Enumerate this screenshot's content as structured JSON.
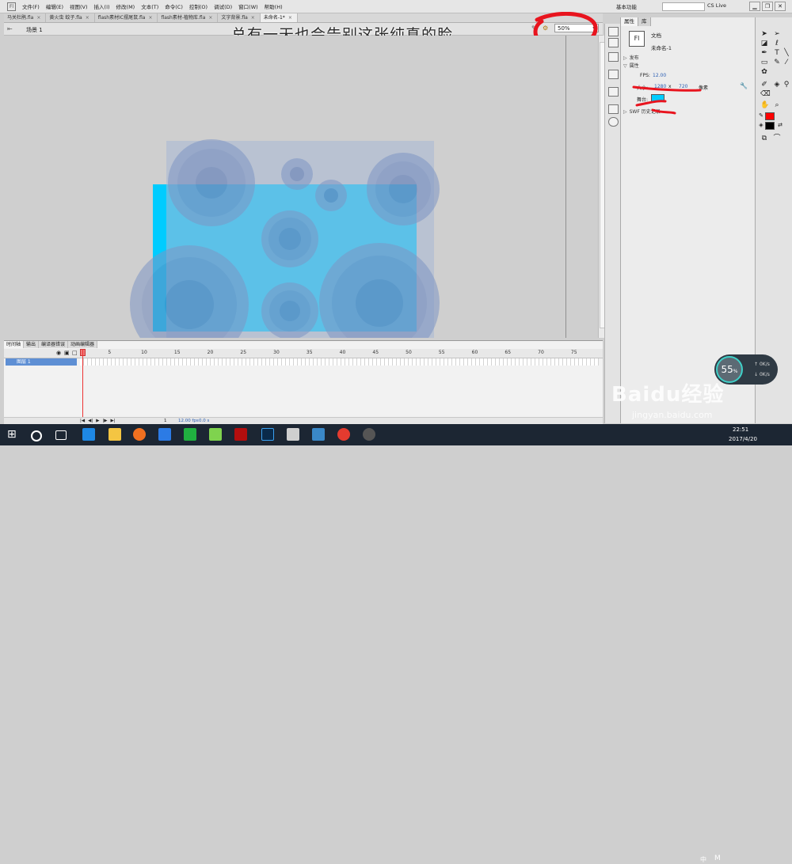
{
  "app": {
    "menu": [
      "文件(F)",
      "编辑(E)",
      "视图(V)",
      "插入(I)",
      "修改(M)",
      "文本(T)",
      "命令(C)",
      "控制(O)",
      "调试(D)",
      "窗口(W)",
      "帮助(H)"
    ],
    "workspace": "基本功能",
    "cs_live": "CS Live",
    "minimize": "▁",
    "restore": "❐",
    "close": "✕"
  },
  "doc_tabs": [
    {
      "label": "马关杜鹃.fla",
      "active": false
    },
    {
      "label": "黄火虫 蚊子.fla",
      "active": false
    },
    {
      "label": "flash素材IC摆尾鼠.fla",
      "active": false
    },
    {
      "label": "flash素材-植物库.fla",
      "active": false
    },
    {
      "label": "文字背景.fla",
      "active": false
    },
    {
      "label": "未命名-1*",
      "active": true
    }
  ],
  "tab_close": "×",
  "edit_bar": {
    "scene": "场景 1",
    "zoom": "50%",
    "caption": "总有一天也会告别这张纯真的脸"
  },
  "stage": {
    "background_color": "#00ccff"
  },
  "timeline": {
    "tabs": [
      "时间轴",
      "输出",
      "编译器错误",
      "动画编辑器"
    ],
    "ruler_ticks": [
      "1",
      "5",
      "10",
      "15",
      "20",
      "25",
      "30",
      "35",
      "40",
      "45",
      "50",
      "55",
      "60",
      "65",
      "70",
      "75"
    ],
    "layer_name": "图层 1",
    "current_frame": "1",
    "fps": "12.00 fps",
    "elapsed": "0.0 s"
  },
  "properties": {
    "tabs": [
      "属性",
      "库"
    ],
    "doc_type": "文档",
    "doc_name": "未命名-1",
    "sections": [
      "发布",
      "属性",
      "SWF 历史记录"
    ],
    "fps_label": "FPS:",
    "fps_value": "12.00",
    "size_label": "大小:",
    "width": "1280",
    "times": "x",
    "height": "720",
    "unit": "像素",
    "stage_label": "舞台:",
    "stage_color": "#00ccff"
  },
  "tools": {
    "stroke_color": "#ff0000",
    "fill_color": "#000000"
  },
  "taskbar": {
    "time": "22:51",
    "date": "2017/4/20",
    "lang": "中",
    "ime": "M"
  },
  "netwidget": {
    "percent": "55",
    "pct_sign": "%",
    "up": "0K/s",
    "down": "0K/s"
  },
  "watermark": {
    "logo": "Baidu经验",
    "url": "jingyan.baidu.com"
  }
}
